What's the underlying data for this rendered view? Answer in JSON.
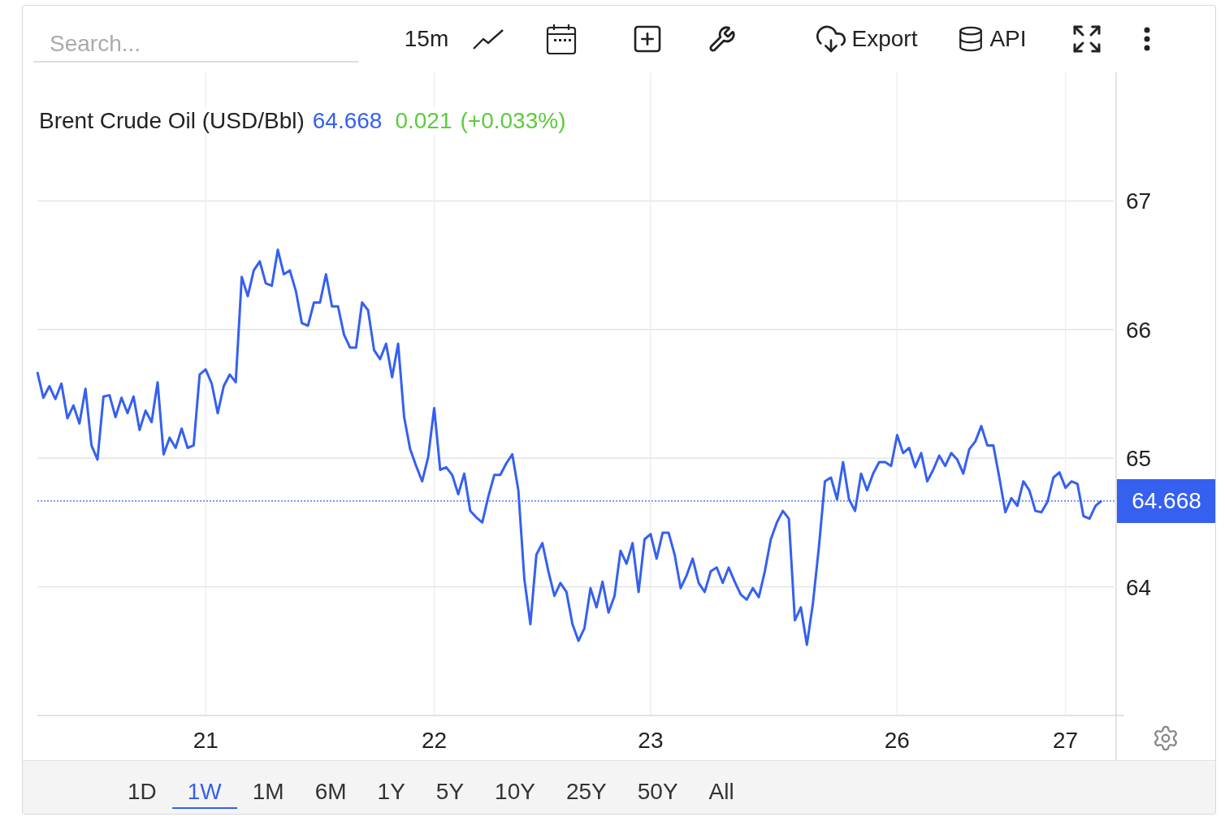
{
  "toolbar": {
    "search": {
      "placeholder": "Search..."
    },
    "interval": "15m",
    "export": "Export",
    "api": "API"
  },
  "quote": {
    "name": "Brent Crude Oil (USD/Bbl)",
    "price": "64.668",
    "change": "0.021",
    "change_pct": "(+0.033%)"
  },
  "chart": {
    "price_label": "64.668",
    "chart_data": {
      "type": "line",
      "grid": true,
      "ref_lines": [
        {
          "axis": "y",
          "value": 64.668
        }
      ],
      "ylim": [
        63,
        68
      ],
      "yticks": [
        64,
        65,
        66,
        67
      ],
      "categories": [
        null,
        null,
        null,
        null,
        null,
        null,
        null,
        null,
        null,
        null,
        null,
        null,
        null,
        null,
        null,
        null,
        null,
        null,
        null,
        null,
        null,
        null,
        null,
        null,
        null,
        null,
        null,
        null,
        "21",
        null,
        null,
        null,
        null,
        null,
        null,
        null,
        null,
        null,
        null,
        null,
        null,
        null,
        null,
        null,
        null,
        null,
        null,
        null,
        null,
        null,
        null,
        null,
        null,
        null,
        null,
        null,
        null,
        null,
        null,
        null,
        null,
        null,
        null,
        null,
        null,
        null,
        "22",
        null,
        null,
        null,
        null,
        null,
        null,
        null,
        null,
        null,
        null,
        null,
        null,
        null,
        null,
        null,
        null,
        null,
        null,
        null,
        null,
        null,
        null,
        null,
        null,
        null,
        null,
        null,
        null,
        null,
        null,
        null,
        null,
        null,
        null,
        null,
        "23",
        null,
        null,
        null,
        null,
        null,
        null,
        null,
        null,
        null,
        null,
        null,
        null,
        null,
        null,
        null,
        null,
        null,
        null,
        null,
        null,
        null,
        null,
        null,
        null,
        null,
        null,
        null,
        null,
        null,
        null,
        null,
        null,
        null,
        null,
        null,
        null,
        null,
        null,
        null,
        null,
        "26",
        null,
        null,
        null,
        null,
        null,
        null,
        null,
        null,
        null,
        null,
        null,
        null,
        null,
        null,
        null,
        null,
        null,
        null,
        null,
        null,
        null,
        null,
        null,
        null,
        null,
        null,
        null,
        "27",
        null,
        null,
        null,
        null,
        null,
        null
      ],
      "series": [
        {
          "color": "#3560f0",
          "values": [
            65.67,
            65.47,
            65.56,
            65.46,
            65.58,
            65.31,
            65.41,
            65.27,
            65.54,
            65.1,
            64.99,
            65.48,
            65.49,
            65.32,
            65.47,
            65.35,
            65.48,
            65.22,
            65.37,
            65.28,
            65.59,
            65.03,
            65.16,
            65.08,
            65.23,
            65.08,
            65.1,
            65.65,
            65.69,
            65.58,
            65.35,
            65.56,
            65.65,
            65.59,
            66.41,
            66.26,
            66.46,
            66.53,
            66.36,
            66.34,
            66.62,
            66.43,
            66.46,
            66.3,
            66.05,
            66.03,
            66.21,
            66.21,
            66.43,
            66.18,
            66.18,
            65.96,
            65.86,
            65.86,
            66.21,
            66.15,
            65.84,
            65.77,
            65.89,
            65.63,
            65.89,
            65.32,
            65.07,
            64.94,
            64.82,
            65.01,
            65.39,
            64.91,
            64.93,
            64.87,
            64.72,
            64.88,
            64.59,
            64.54,
            64.5,
            64.7,
            64.87,
            64.87,
            64.96,
            65.03,
            64.75,
            64.06,
            63.71,
            64.25,
            64.34,
            64.12,
            63.93,
            64.03,
            63.96,
            63.71,
            63.58,
            63.68,
            63.99,
            63.84,
            64.04,
            63.8,
            63.93,
            64.28,
            64.18,
            64.34,
            63.96,
            64.37,
            64.41,
            64.22,
            64.42,
            64.42,
            64.25,
            63.99,
            64.09,
            64.22,
            64.03,
            63.96,
            64.12,
            64.15,
            64.03,
            64.15,
            64.04,
            63.94,
            63.9,
            63.99,
            63.92,
            64.12,
            64.37,
            64.5,
            64.59,
            64.53,
            63.74,
            63.84,
            63.55,
            63.87,
            64.31,
            64.82,
            64.85,
            64.68,
            64.97,
            64.68,
            64.59,
            64.88,
            64.75,
            64.88,
            64.97,
            64.97,
            64.94,
            65.18,
            65.04,
            65.08,
            64.93,
            65.04,
            64.82,
            64.91,
            65.02,
            64.94,
            65.04,
            64.99,
            64.88,
            65.07,
            65.13,
            65.25,
            65.1,
            65.1,
            64.85,
            64.58,
            64.69,
            64.63,
            64.82,
            64.75,
            64.59,
            64.58,
            64.66,
            64.85,
            64.89,
            64.77,
            64.82,
            64.8,
            64.55,
            64.53,
            64.63,
            64.67
          ]
        }
      ]
    }
  },
  "range_tabs": [
    {
      "label": "1D",
      "selected": false
    },
    {
      "label": "1W",
      "selected": true
    },
    {
      "label": "1M",
      "selected": false
    },
    {
      "label": "6M",
      "selected": false
    },
    {
      "label": "1Y",
      "selected": false
    },
    {
      "label": "5Y",
      "selected": false
    },
    {
      "label": "10Y",
      "selected": false
    },
    {
      "label": "25Y",
      "selected": false
    },
    {
      "label": "50Y",
      "selected": false
    },
    {
      "label": "All",
      "selected": false
    }
  ]
}
